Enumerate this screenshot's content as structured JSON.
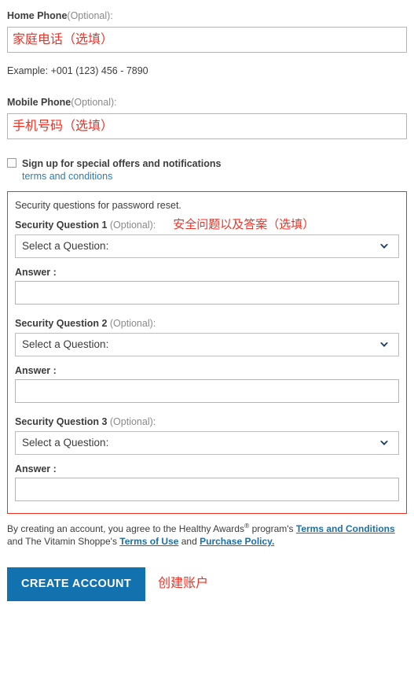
{
  "form": {
    "home_phone": {
      "label": "Home Phone",
      "optional": "(Optional):",
      "value": "",
      "annotation": "家庭电话（选填）",
      "example": "Example: +001 (123) 456 - 7890"
    },
    "mobile_phone": {
      "label": "Mobile Phone",
      "optional": "(Optional):",
      "value": "",
      "annotation": "手机号码（选填）"
    },
    "signup": {
      "checked": false,
      "label": "Sign up for special offers and notifications",
      "terms_link": "terms and conditions"
    },
    "security": {
      "note": "Security questions for password reset.",
      "annotation": "安全问题以及答案（选填）",
      "answer_label": "Answer :",
      "select_placeholder": "Select a Question:",
      "questions": [
        {
          "label": "Security Question 1",
          "optional": "(Optional):",
          "selected": "Select a Question:",
          "answer": ""
        },
        {
          "label": "Security Question 2",
          "optional": "(Optional):",
          "selected": "Select a Question:",
          "answer": ""
        },
        {
          "label": "Security Question 3",
          "optional": "(Optional):",
          "selected": "Select a Question:",
          "answer": ""
        }
      ]
    },
    "legal": {
      "part1": "By creating an account, you agree to the Healthy Awards",
      "registered_mark": "®",
      "part2": " program's ",
      "link_terms_conditions": "Terms and Conditions",
      "part3": " and The Vitamin Shoppe's ",
      "link_terms_of_use": "Terms of Use",
      "part4": " and ",
      "link_purchase_policy": "Purchase Policy."
    },
    "submit": {
      "label": "CREATE ACCOUNT",
      "annotation": "创建账户"
    }
  },
  "colors": {
    "annotation_red": "#ef3124",
    "button_blue": "#1272b0",
    "link_blue": "#2e7cb6",
    "legal_link_blue": "#1f6ea8",
    "chevron_navy": "#1b3d6d"
  }
}
